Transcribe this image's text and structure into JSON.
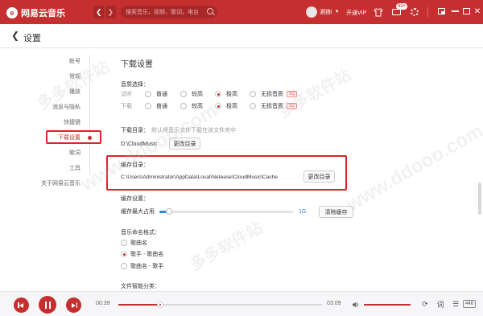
{
  "app": {
    "name": "网易云音乐",
    "logo_glyph": "e",
    "accent": "#c62f2f"
  },
  "search": {
    "placeholder": "搜索音乐，视频，歌词，电台"
  },
  "user": {
    "name": "酒狼i",
    "vip_label": "开通VIP",
    "message_badge": "99+"
  },
  "page": {
    "title": "设置"
  },
  "sidebar": {
    "items": [
      {
        "label": "帐号",
        "active": false
      },
      {
        "label": "常规",
        "active": false
      },
      {
        "label": "播放",
        "active": false
      },
      {
        "label": "消息与隐私",
        "active": false
      },
      {
        "label": "快捷键",
        "active": false
      },
      {
        "label": "下载设置",
        "active": true
      },
      {
        "label": "歌词",
        "active": false
      },
      {
        "label": "工具",
        "active": false
      },
      {
        "label": "关于网易云音乐",
        "active": false
      }
    ]
  },
  "download": {
    "section_title": "下载设置",
    "quality_label": "音质选择：",
    "trial_label": "试听",
    "download_label": "下载",
    "options": [
      "普通",
      "较高",
      "极高",
      "无损音质"
    ],
    "sq_tag": "SQ",
    "trial_selected": "极高",
    "download_selected": "极高",
    "dir_label": "下载目录：",
    "dir_hint": "默认将音乐文件下载在该文件夹中",
    "dir_path": "D:\\CloudMusic",
    "change_dir_label": "更改目录"
  },
  "cache": {
    "dir_label": "缓存目录：",
    "dir_path": "C:\\Users\\Administrator\\AppData\\Local\\Netease\\CloudMusic\\Cache",
    "change_dir_label": "更改目录",
    "settings_label": "缓存设置：",
    "max_label": "缓存最大占用",
    "max_value": "1G",
    "level_fraction": 0.07,
    "clear_label": "清除缓存"
  },
  "naming": {
    "title": "音乐命名格式：",
    "options": [
      "歌曲名",
      "歌手 - 歌曲名",
      "歌曲名 - 歌手"
    ],
    "selected_index": 1
  },
  "smart_category": {
    "title": "文件智能分类："
  },
  "player": {
    "elapsed": "00:39",
    "total": "03:09",
    "progress_fraction": 0.206,
    "volume_fraction": 1.0,
    "playlist_count": "446"
  },
  "watermark": {
    "text": "多多软件站",
    "url_text": "www.ddooo.com"
  }
}
